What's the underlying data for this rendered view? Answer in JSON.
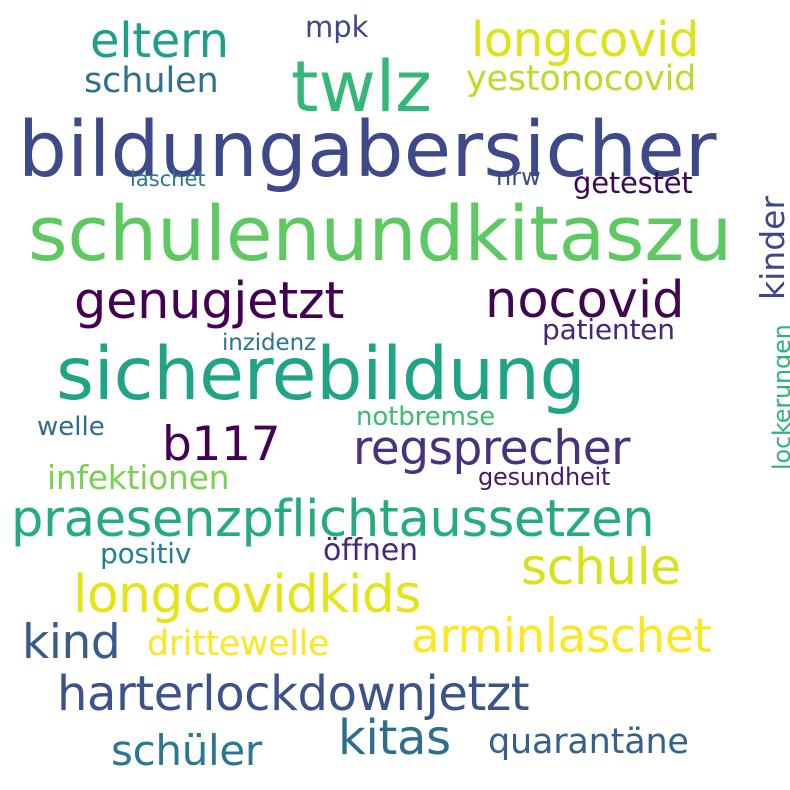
{
  "words": [
    {
      "text": "bildungabersicher",
      "color": "#3e4989"
    },
    {
      "text": "schulenundkitaszu",
      "color": "#5ec962"
    },
    {
      "text": "sicherebildung",
      "color": "#20a486"
    },
    {
      "text": "praesenzpflichtaussetzen",
      "color": "#25ab82"
    },
    {
      "text": "harterlockdownjetzt",
      "color": "#3b528b"
    },
    {
      "text": "twlz",
      "color": "#35b779"
    },
    {
      "text": "genugjetzt",
      "color": "#440154"
    },
    {
      "text": "nocovid",
      "color": "#3e0751"
    },
    {
      "text": "regsprecher",
      "color": "#46327e"
    },
    {
      "text": "arminlaschet",
      "color": "#fde725"
    },
    {
      "text": "longcovidkids",
      "color": "#e5e419"
    },
    {
      "text": "eltern",
      "color": "#1f9e89"
    },
    {
      "text": "longcovid",
      "color": "#dde318"
    },
    {
      "text": "schule",
      "color": "#d8e219"
    },
    {
      "text": "kitas",
      "color": "#2d708e"
    },
    {
      "text": "b117",
      "color": "#440154"
    },
    {
      "text": "kind",
      "color": "#375b8d"
    },
    {
      "text": "schüler",
      "color": "#2a788e"
    },
    {
      "text": "quarantäne",
      "color": "#355f8d"
    },
    {
      "text": "schulen",
      "color": "#2c728e"
    },
    {
      "text": "yestonocovid",
      "color": "#b5de2b"
    },
    {
      "text": "drittewelle",
      "color": "#fde725"
    },
    {
      "text": "infektionen",
      "color": "#7ad151"
    },
    {
      "text": "kinder",
      "color": "#414487"
    },
    {
      "text": "positiv",
      "color": "#277f8e"
    },
    {
      "text": "öffnen",
      "color": "#482878"
    },
    {
      "text": "getestet",
      "color": "#3e0751"
    },
    {
      "text": "mpk",
      "color": "#3f4788"
    },
    {
      "text": "patienten",
      "color": "#482576"
    },
    {
      "text": "notbremse",
      "color": "#3cbb75"
    },
    {
      "text": "welle",
      "color": "#2f6b8e"
    },
    {
      "text": "lockerungen",
      "color": "#2fb47c"
    },
    {
      "text": "gesundheit",
      "color": "#481a6c"
    },
    {
      "text": "inzidenz",
      "color": "#2b758e"
    },
    {
      "text": "laschet",
      "color": "#2a788e"
    },
    {
      "text": "nrw",
      "color": "#3e4a89"
    }
  ]
}
